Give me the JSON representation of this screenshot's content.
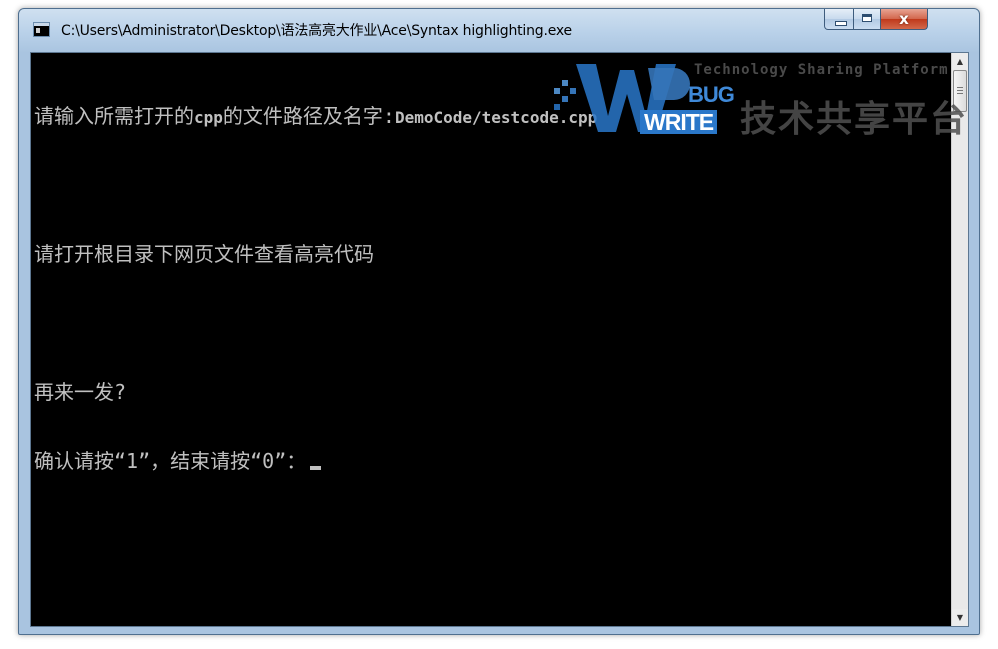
{
  "window": {
    "title": "C:\\Users\\Administrator\\Desktop\\语法高亮大作业\\Ace\\Syntax highlighting.exe",
    "minimize_glyph": "",
    "close_glyph": "x"
  },
  "console": {
    "line1_prompt": "请输入所需打开的",
    "line1_cpp": "cpp",
    "line1_suffix": "的文件路径及名字:",
    "line1_input": "DemoCode/testcode.cpp",
    "line2": "请打开根目录下网页文件查看高亮代码",
    "line3": "再来一发?",
    "line4": "确认请按“1”，结束请按“0”："
  },
  "watermark": {
    "tagline": "Technology Sharing Platform",
    "brand_top": "BUG",
    "brand_bottom": "WRITE",
    "brand_cn": "技术共享平台"
  },
  "icons": {
    "app": "console-app-icon",
    "minimize": "minimize-icon",
    "maximize": "maximize-icon",
    "close": "close-icon",
    "scroll_up": "scroll-up-arrow-icon",
    "scroll_down": "scroll-down-arrow-icon"
  },
  "colors": {
    "console_bg": "#000000",
    "console_fg": "#c0c0c0",
    "close_button": "#c0391b",
    "titlebar": "#b9d1e9"
  }
}
